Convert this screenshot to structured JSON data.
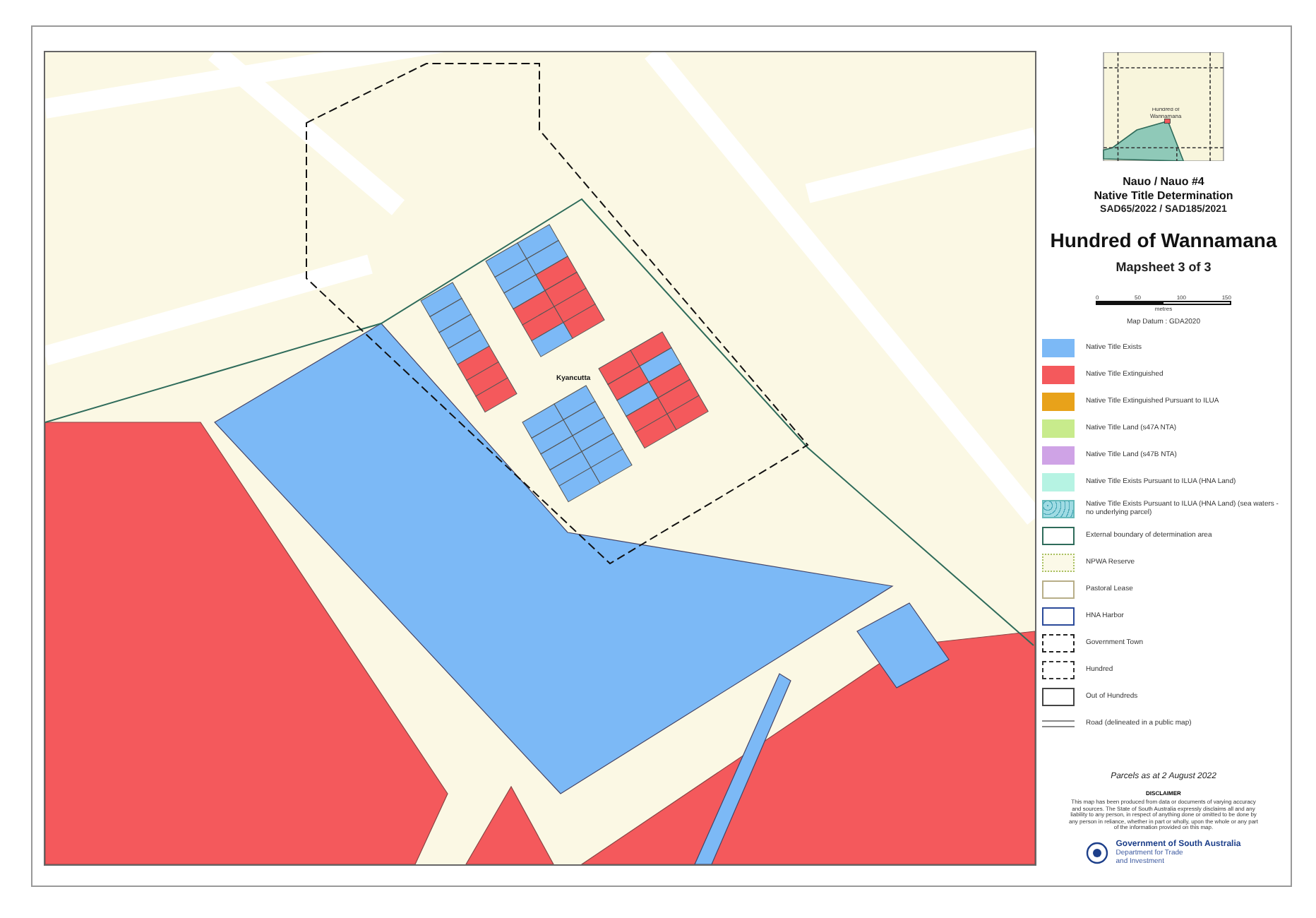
{
  "map": {
    "town_label": "Kyancutta"
  },
  "inset": {
    "label": "Hundred of Wannamana"
  },
  "header": {
    "title_lines": [
      "Nauo / Nauo #4",
      "Native Title Determination"
    ],
    "case_numbers": "SAD65/2022 / SAD185/2021",
    "hundred": "Hundred of Wannamana",
    "mapsheet": "Mapsheet 3 of 3"
  },
  "scale": {
    "ticks": [
      "0",
      "50",
      "100",
      "150"
    ],
    "unit": "metres",
    "datum": "Map Datum : GDA2020"
  },
  "legend": [
    {
      "kind": "fill",
      "color": "#7cb9f6",
      "label": "Native Title Exists"
    },
    {
      "kind": "fill",
      "color": "#f4595c",
      "label": "Native Title Extinguished"
    },
    {
      "kind": "fill",
      "color": "#e8a21a",
      "label": "Native Title Extinguished Pursuant to ILUA"
    },
    {
      "kind": "fill",
      "color": "#c8eb8c",
      "label": "Native Title Land (s47A NTA)"
    },
    {
      "kind": "fill",
      "color": "#cfa3e6",
      "label": "Native Title Land (s47B NTA)"
    },
    {
      "kind": "fill",
      "color": "#b6f3e3",
      "label": "Native Title Exists Pursuant to ILUA (HNA Land)"
    },
    {
      "kind": "pattern",
      "color": "#9fdbe3",
      "label": "Native Title Exists Pursuant to ILUA (HNA Land) (sea waters - no underlying parcel)"
    },
    {
      "kind": "outline",
      "color": "#2e6b5a",
      "label": "External boundary of determination area"
    },
    {
      "kind": "dotted",
      "color": "#a8c060",
      "label": "NPWA Reserve"
    },
    {
      "kind": "outline",
      "color": "#b8ae88",
      "label": "Pastoral Lease"
    },
    {
      "kind": "outline",
      "color": "#2b4a9a",
      "label": "HNA Harbor"
    },
    {
      "kind": "dashed",
      "color": "#222222",
      "label": "Government Town"
    },
    {
      "kind": "longdash",
      "color": "#333333",
      "label": "Hundred"
    },
    {
      "kind": "outline",
      "color": "#444444",
      "label": "Out of Hundreds"
    },
    {
      "kind": "road",
      "color": "#888888",
      "label": "Road (delineated in a public map)"
    }
  ],
  "parcels_date": "Parcels as at 2 August 2022",
  "disclaimer": {
    "title": "DISCLAIMER",
    "text": "This map has been produced from data or documents of varying accuracy and sources. The State of South Australia expressly disclaims all and any liability to any person, in respect of anything done or omitted to be done by any person in reliance, whether in part or wholly, upon the whole or any part of the information provided on this map."
  },
  "agency": {
    "name": "Government of South Australia",
    "department_lines": [
      "Department for Trade",
      "and Investment"
    ]
  }
}
